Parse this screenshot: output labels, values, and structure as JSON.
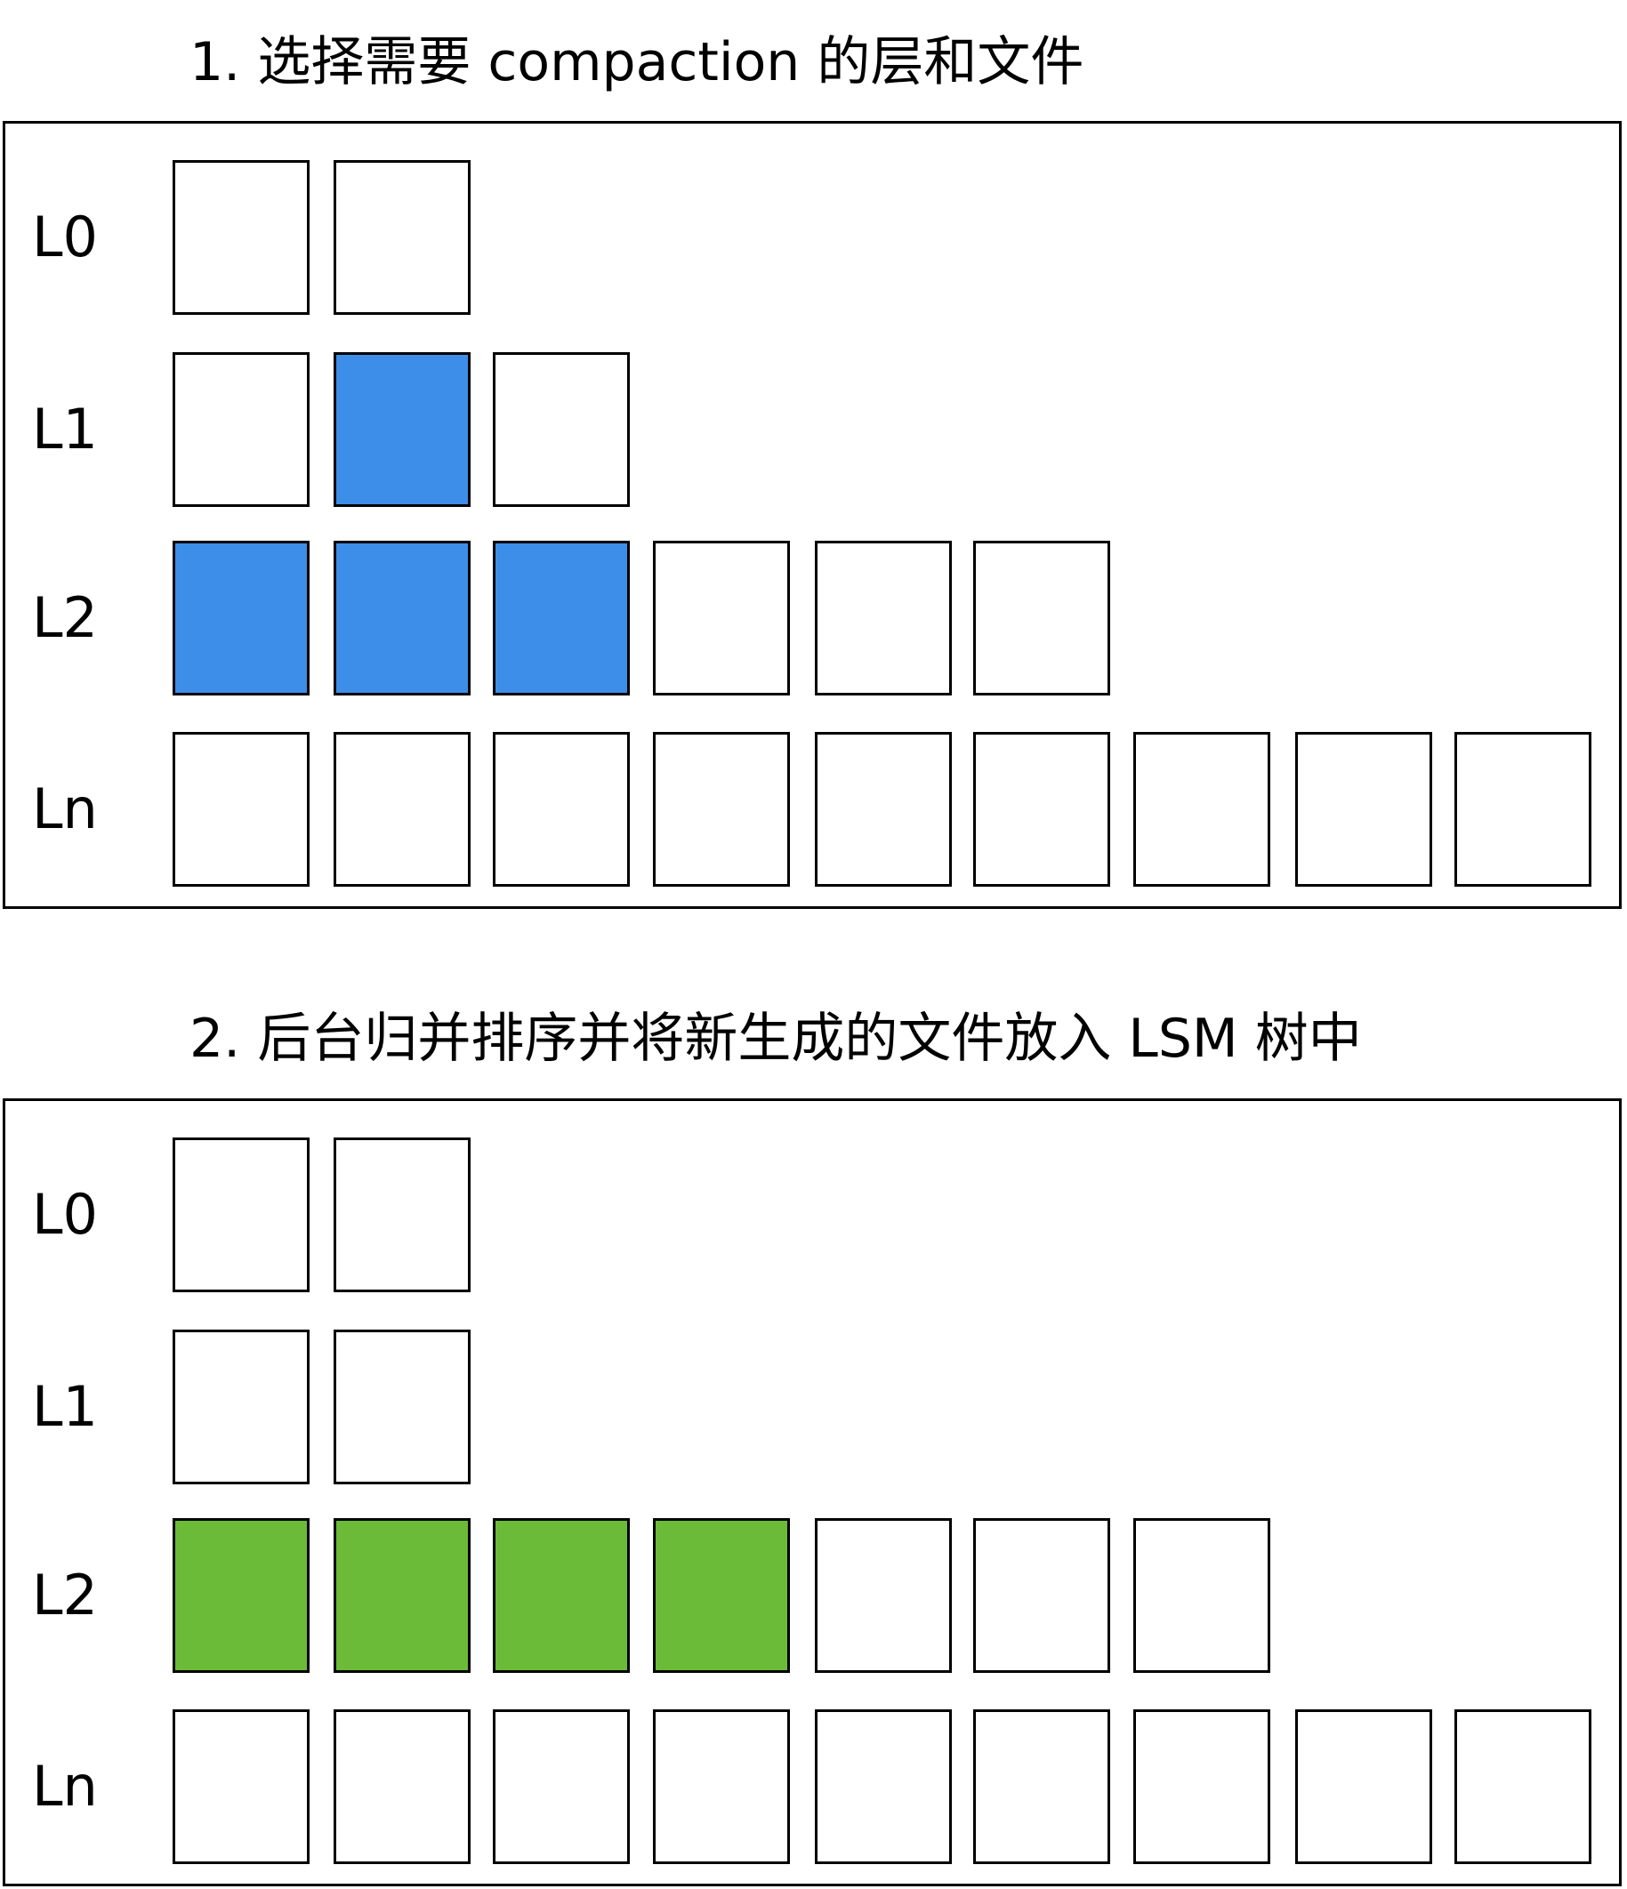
{
  "colors": {
    "empty": "#ffffff",
    "selected": "#3d8ee9",
    "generated": "#6bbb38",
    "border": "#000000"
  },
  "panels": [
    {
      "title": "1. 选择需要 compaction 的层和文件",
      "levels": [
        {
          "label": "L0",
          "files": [
            "empty",
            "empty"
          ]
        },
        {
          "label": "L1",
          "files": [
            "empty",
            "selected",
            "empty"
          ]
        },
        {
          "label": "L2",
          "files": [
            "selected",
            "selected",
            "selected",
            "empty",
            "empty",
            "empty"
          ]
        },
        {
          "label": "Ln",
          "files": [
            "empty",
            "empty",
            "empty",
            "empty",
            "empty",
            "empty",
            "empty",
            "empty",
            "empty"
          ]
        }
      ]
    },
    {
      "title": "2. 后台归并排序并将新生成的文件放入 LSM 树中",
      "levels": [
        {
          "label": "L0",
          "files": [
            "empty",
            "empty"
          ]
        },
        {
          "label": "L1",
          "files": [
            "empty",
            "empty"
          ]
        },
        {
          "label": "L2",
          "files": [
            "generated",
            "generated",
            "generated",
            "generated",
            "empty",
            "empty",
            "empty"
          ]
        },
        {
          "label": "Ln",
          "files": [
            "empty",
            "empty",
            "empty",
            "empty",
            "empty",
            "empty",
            "empty",
            "empty",
            "empty"
          ]
        }
      ]
    }
  ]
}
